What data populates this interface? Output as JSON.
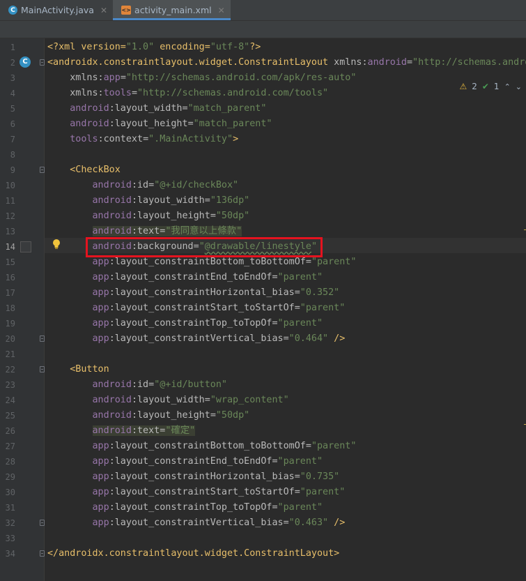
{
  "tabs": [
    {
      "label": "MainActivity.java",
      "icon": "class-icon",
      "active": false
    },
    {
      "label": "activity_main.xml",
      "icon": "xml-file-icon",
      "active": true
    }
  ],
  "inspections": {
    "warnings": "2",
    "checks": "1"
  },
  "current_line": 14,
  "line_numbers": [
    "1",
    "2",
    "3",
    "4",
    "5",
    "6",
    "7",
    "8",
    "9",
    "10",
    "11",
    "12",
    "13",
    "14",
    "15",
    "16",
    "17",
    "18",
    "19",
    "20",
    "21",
    "22",
    "23",
    "24",
    "25",
    "26",
    "27",
    "28",
    "29",
    "30",
    "31",
    "32",
    "33",
    "34"
  ],
  "code": {
    "l1": {
      "a": "<?xml version=",
      "b": "\"1.0\"",
      "c": " encoding=",
      "d": "\"utf-8\"",
      "e": "?>"
    },
    "l2": {
      "tag": "<androidx.constraintlayout.widget.ConstraintLayout",
      "attr": " xmlns:",
      "ns": "android",
      "eq": "=",
      "val": "\"http://schemas.andro"
    },
    "l3": {
      "attr": "xmlns:",
      "ns": "app",
      "eq": "=",
      "val": "\"http://schemas.android.com/apk/res-auto\""
    },
    "l4": {
      "attr": "xmlns:",
      "ns": "tools",
      "eq": "=",
      "val": "\"http://schemas.android.com/tools\""
    },
    "l5": {
      "ns": "android",
      "attr": ":layout_width",
      "eq": "=",
      "val": "\"match_parent\""
    },
    "l6": {
      "ns": "android",
      "attr": ":layout_height",
      "eq": "=",
      "val": "\"match_parent\""
    },
    "l7": {
      "ns": "tools",
      "attr": ":context",
      "eq": "=",
      "val": "\".MainActivity\"",
      "end": ">"
    },
    "l9": {
      "tag": "<CheckBox"
    },
    "l10": {
      "ns": "android",
      "attr": ":id",
      "eq": "=",
      "val": "\"@+id/checkBox\""
    },
    "l11": {
      "ns": "android",
      "attr": ":layout_width",
      "eq": "=",
      "val": "\"136dp\""
    },
    "l12": {
      "ns": "android",
      "attr": ":layout_height",
      "eq": "=",
      "val": "\"50dp\""
    },
    "l13": {
      "ns": "android",
      "attr": ":text",
      "eq": "=",
      "val": "\"我同意以上條款\""
    },
    "l14": {
      "ns": "android",
      "attr": ":background",
      "eq": "=",
      "q1": "\"",
      "val": "@drawable/linestyle",
      "q2": "\""
    },
    "l15": {
      "ns": "app",
      "attr": ":layout_constraintBottom_toBottomOf",
      "eq": "=",
      "val": "\"parent\""
    },
    "l16": {
      "ns": "app",
      "attr": ":layout_constraintEnd_toEndOf",
      "eq": "=",
      "val": "\"parent\""
    },
    "l17": {
      "ns": "app",
      "attr": ":layout_constraintHorizontal_bias",
      "eq": "=",
      "val": "\"0.352\""
    },
    "l18": {
      "ns": "app",
      "attr": ":layout_constraintStart_toStartOf",
      "eq": "=",
      "val": "\"parent\""
    },
    "l19": {
      "ns": "app",
      "attr": ":layout_constraintTop_toTopOf",
      "eq": "=",
      "val": "\"parent\""
    },
    "l20": {
      "ns": "app",
      "attr": ":layout_constraintVertical_bias",
      "eq": "=",
      "val": "\"0.464\"",
      "end": " />"
    },
    "l22": {
      "tag": "<Button"
    },
    "l23": {
      "ns": "android",
      "attr": ":id",
      "eq": "=",
      "val": "\"@+id/button\""
    },
    "l24": {
      "ns": "android",
      "attr": ":layout_width",
      "eq": "=",
      "val": "\"wrap_content\""
    },
    "l25": {
      "ns": "android",
      "attr": ":layout_height",
      "eq": "=",
      "val": "\"50dp\""
    },
    "l26": {
      "ns": "android",
      "attr": ":text",
      "eq": "=",
      "val": "\"確定\""
    },
    "l27": {
      "ns": "app",
      "attr": ":layout_constraintBottom_toBottomOf",
      "eq": "=",
      "val": "\"parent\""
    },
    "l28": {
      "ns": "app",
      "attr": ":layout_constraintEnd_toEndOf",
      "eq": "=",
      "val": "\"parent\""
    },
    "l29": {
      "ns": "app",
      "attr": ":layout_constraintHorizontal_bias",
      "eq": "=",
      "val": "\"0.735\""
    },
    "l30": {
      "ns": "app",
      "attr": ":layout_constraintStart_toStartOf",
      "eq": "=",
      "val": "\"parent\""
    },
    "l31": {
      "ns": "app",
      "attr": ":layout_constraintTop_toTopOf",
      "eq": "=",
      "val": "\"parent\""
    },
    "l32": {
      "ns": "app",
      "attr": ":layout_constraintVertical_bias",
      "eq": "=",
      "val": "\"0.463\"",
      "end": " />"
    },
    "l34": {
      "tag": "</androidx.constraintlayout.widget.ConstraintLayout",
      "end": ">"
    }
  },
  "colors": {
    "background": "#2b2b2b",
    "tag": "#e8bf6a",
    "namespace": "#9876aa",
    "attribute": "#bababa",
    "string": "#6a8759",
    "highlight_box": "#e5131f"
  }
}
